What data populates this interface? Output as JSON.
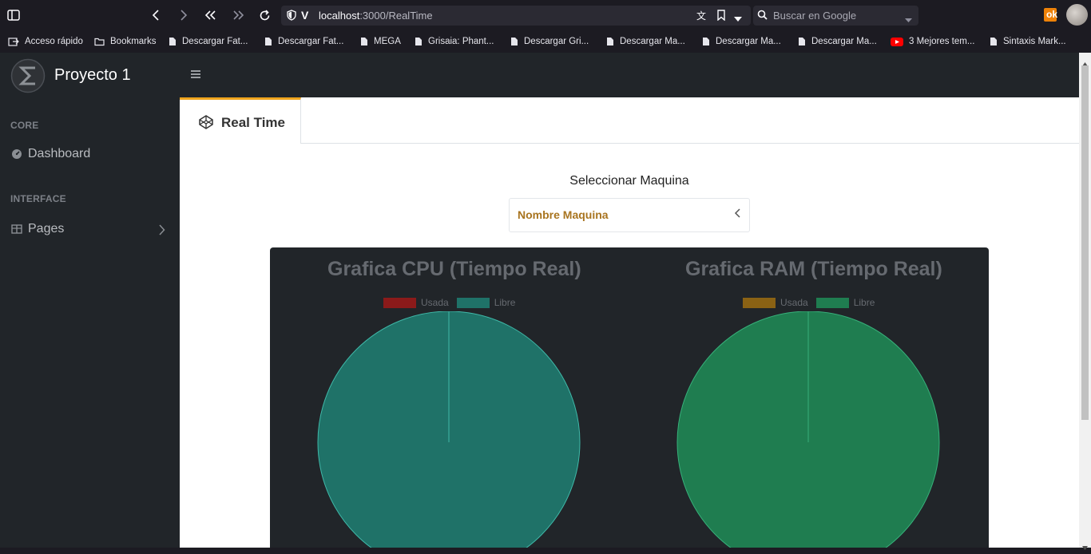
{
  "browser": {
    "url_host": "localhost",
    "url_path": ":3000/RealTime",
    "search_placeholder": "Buscar en Google"
  },
  "bookmarks": [
    {
      "label": "Acceso rápido",
      "icon": "quick-access-icon"
    },
    {
      "label": "Bookmarks",
      "icon": "folder-icon"
    },
    {
      "label": "Descargar Fat...",
      "icon": "page-icon"
    },
    {
      "label": "Descargar Fat...",
      "icon": "page-icon"
    },
    {
      "label": "MEGA",
      "icon": "page-icon"
    },
    {
      "label": "Grisaia: Phant...",
      "icon": "page-icon"
    },
    {
      "label": "Descargar Gri...",
      "icon": "page-icon"
    },
    {
      "label": "Descargar Ma...",
      "icon": "page-icon"
    },
    {
      "label": "Descargar Ma...",
      "icon": "page-icon"
    },
    {
      "label": "Descargar Ma...",
      "icon": "page-icon"
    },
    {
      "label": "3 Mejores tem...",
      "icon": "youtube-icon"
    },
    {
      "label": "Sintaxis Mark...",
      "icon": "page-icon"
    }
  ],
  "app": {
    "brand": "Proyecto 1"
  },
  "sidebar": {
    "core_heading": "CORE",
    "dashboard_label": "Dashboard",
    "interface_heading": "INTERFACE",
    "pages_label": "Pages"
  },
  "tab": {
    "label": "Real Time"
  },
  "machine_select": {
    "title": "Seleccionar Maquina",
    "selected": "Nombre Maquina"
  },
  "colors": {
    "accent": "#f0a51e",
    "select_text": "#a8741f",
    "cpu_used": "#8b1a1a",
    "cpu_free": "#1f7268",
    "ram_used": "#8a6214",
    "ram_free": "#1f7d50"
  },
  "chart_data": [
    {
      "type": "pie",
      "title": "Grafica CPU (Tiempo Real)",
      "categories": [
        "Usada",
        "Libre"
      ],
      "values": [
        0,
        100
      ],
      "legend": "top"
    },
    {
      "type": "pie",
      "title": "Grafica RAM (Tiempo Real)",
      "categories": [
        "Usada",
        "Libre"
      ],
      "values": [
        0,
        100
      ],
      "legend": "top"
    }
  ]
}
